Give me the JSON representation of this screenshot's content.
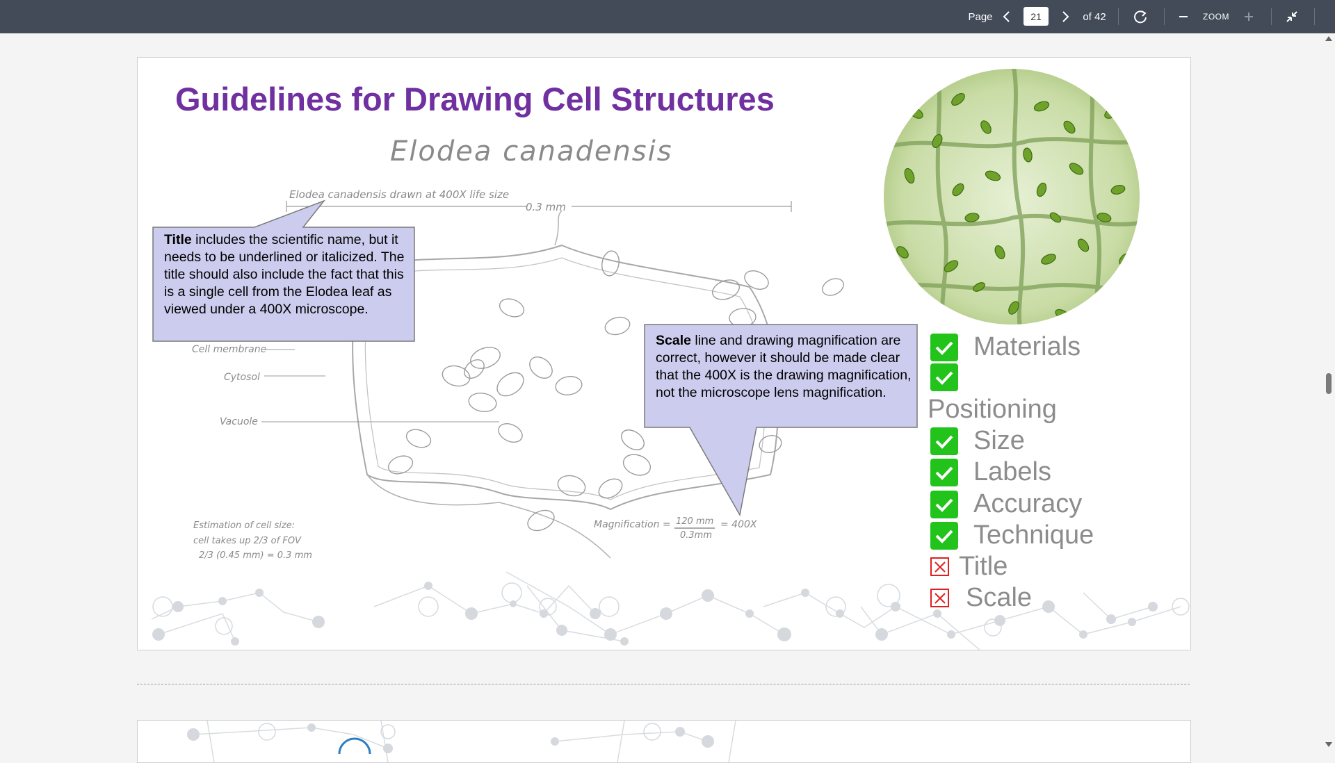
{
  "toolbar": {
    "page_label": "Page",
    "current_page": "21",
    "total_pages": "of 42",
    "zoom_label": "ZOOM"
  },
  "slide": {
    "title": "Guidelines for Drawing Cell Structures",
    "drawing": {
      "heading": "Elodea canadensis",
      "caption": "Elodea canadensis drawn at 400X life size",
      "scale_label": "0.3 mm",
      "labels": [
        "Cell membrane",
        "Cytosol",
        "Vacuole"
      ],
      "estimation_lines": [
        "Estimation of cell size:",
        "cell takes up 2/3 of FOV",
        "2/3 (0.45 mm) = 0.3 mm"
      ],
      "magnification_prefix": "Magnification =",
      "magnification_numerator": "120 mm",
      "magnification_denominator": "0.3mm",
      "magnification_result": "= 400X"
    },
    "callout_title": {
      "bold": "Title",
      "text": " includes the scientific name, but it needs to be underlined or italicized. The title should also include the fact that this is a single cell from the Elodea leaf as viewed under a 400X microscope."
    },
    "callout_scale": {
      "bold": "Scale",
      "text": " line and drawing magnification are correct, however it should be made clear that the 400X is the drawing magnification, not the microscope lens magnification."
    },
    "checklist": [
      {
        "label": "Materials",
        "status": "check"
      },
      {
        "label": "Positioning",
        "status": "check"
      },
      {
        "label": "Size",
        "status": "check"
      },
      {
        "label": "Labels",
        "status": "check"
      },
      {
        "label": "Accuracy",
        "status": "check"
      },
      {
        "label": "Technique",
        "status": "check"
      },
      {
        "label": "Title",
        "status": "x"
      },
      {
        "label": "Scale",
        "status": "x"
      }
    ]
  },
  "colors": {
    "toolbar_bg": "#434b59",
    "title": "#7030a0",
    "check_green": "#22c31b",
    "x_red": "#e02020",
    "callout_fill": "#ccccee"
  }
}
